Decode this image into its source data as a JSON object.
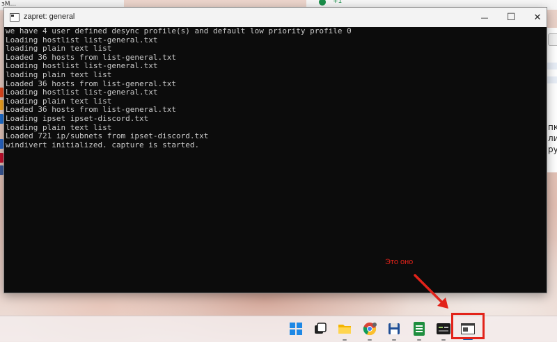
{
  "window": {
    "title": "zapret: general",
    "controls": {
      "minimize": "—",
      "maximize": "☐",
      "close": "✕"
    }
  },
  "console": {
    "lines": [
      "we have 4 user defined desync profile(s) and default low priority profile 0",
      "Loading hostlist list-general.txt",
      "loading plain text list",
      "Loaded 36 hosts from list-general.txt",
      "Loading hostlist list-general.txt",
      "loading plain text list",
      "Loaded 36 hosts from list-general.txt",
      "Loading hostlist list-general.txt",
      "loading plain text list",
      "Loaded 36 hosts from list-general.txt",
      "Loading ipset ipset-discord.txt",
      "loading plain text list",
      "Loaded 721 ip/subnets from ipset-discord.txt",
      "windivert initialized. capture is started."
    ]
  },
  "annotation": {
    "text": "Это оно",
    "color": "#e2231a"
  },
  "background_fragments": {
    "left_label": "зМ...",
    "right_texts": [
      "пке",
      "лис",
      "руг"
    ],
    "top_counter": "+1"
  },
  "taskbar": {
    "items": [
      {
        "name": "start",
        "icon": "windows-start-icon"
      },
      {
        "name": "task-view",
        "icon": "task-view-icon"
      },
      {
        "name": "file-explorer",
        "icon": "folder-icon"
      },
      {
        "name": "chrome",
        "icon": "chrome-icon"
      },
      {
        "name": "save-app",
        "icon": "floppy-disk-icon"
      },
      {
        "name": "sheets",
        "icon": "spreadsheet-icon"
      },
      {
        "name": "terminal-ide",
        "icon": "terminal-icon"
      },
      {
        "name": "zapret-console",
        "icon": "console-window-icon",
        "active": true
      }
    ]
  }
}
